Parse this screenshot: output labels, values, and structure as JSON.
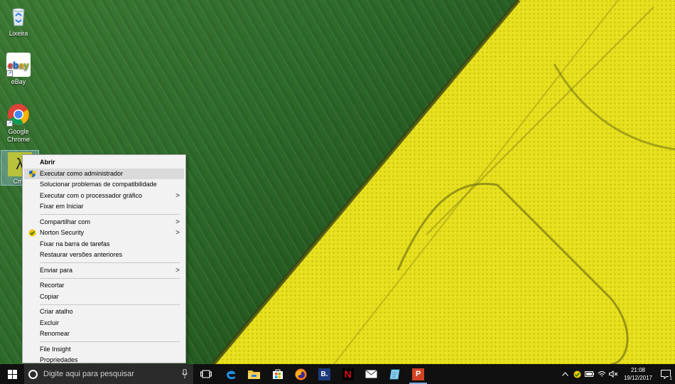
{
  "desktop": {
    "icons": [
      {
        "label": "Lixeira",
        "icon": "recycle-bin-icon"
      },
      {
        "label": "eBay",
        "icon": "ebay-icon",
        "badge": "ebay"
      },
      {
        "label": "Google Chrome",
        "icon": "chrome-icon"
      },
      {
        "label": "Cmd",
        "icon": "cmder-lambda-icon",
        "glyph": "λ"
      }
    ]
  },
  "context_menu": {
    "items": [
      {
        "label": "Abrir",
        "bold": true
      },
      {
        "label": "Executar como administrador",
        "icon": "uac-shield-icon",
        "hover": true
      },
      {
        "label": "Solucionar problemas de compatibilidade"
      },
      {
        "label": "Executar com o processador gráfico",
        "submenu": true
      },
      {
        "label": "Fixar em Iniciar"
      },
      {
        "separator": true
      },
      {
        "label": "Compartilhar com",
        "submenu": true
      },
      {
        "label": "Norton Security",
        "icon": "norton-check-icon",
        "submenu": true
      },
      {
        "label": "Fixar na barra de tarefas"
      },
      {
        "label": "Restaurar versões anteriores"
      },
      {
        "separator": true
      },
      {
        "label": "Enviar para",
        "submenu": true
      },
      {
        "separator": true
      },
      {
        "label": "Recortar"
      },
      {
        "label": "Copiar"
      },
      {
        "separator": true
      },
      {
        "label": "Criar atalho"
      },
      {
        "label": "Excluir"
      },
      {
        "label": "Renomear"
      },
      {
        "separator": true
      },
      {
        "label": "File Insight"
      },
      {
        "label": "Propriedades"
      }
    ],
    "submenu_glyph": ">"
  },
  "taskbar": {
    "search_placeholder": "Digite aqui para pesquisar",
    "apps": [
      {
        "name": "task-view-icon"
      },
      {
        "name": "edge-icon"
      },
      {
        "name": "file-explorer-icon"
      },
      {
        "name": "store-icon"
      },
      {
        "name": "firefox-icon"
      },
      {
        "name": "booking-icon",
        "glyph": "B."
      },
      {
        "name": "netflix-icon",
        "glyph": "N"
      },
      {
        "name": "mail-icon"
      },
      {
        "name": "notepad-icon"
      },
      {
        "name": "powerpoint-icon",
        "glyph": "P",
        "active": true
      }
    ],
    "clock": {
      "time": "21:08",
      "date": "19/12/2017"
    },
    "notification_count": "1",
    "colors": {
      "bar": "#101010",
      "search": "#2b2b2b",
      "accent": "#7aa7d6"
    }
  }
}
